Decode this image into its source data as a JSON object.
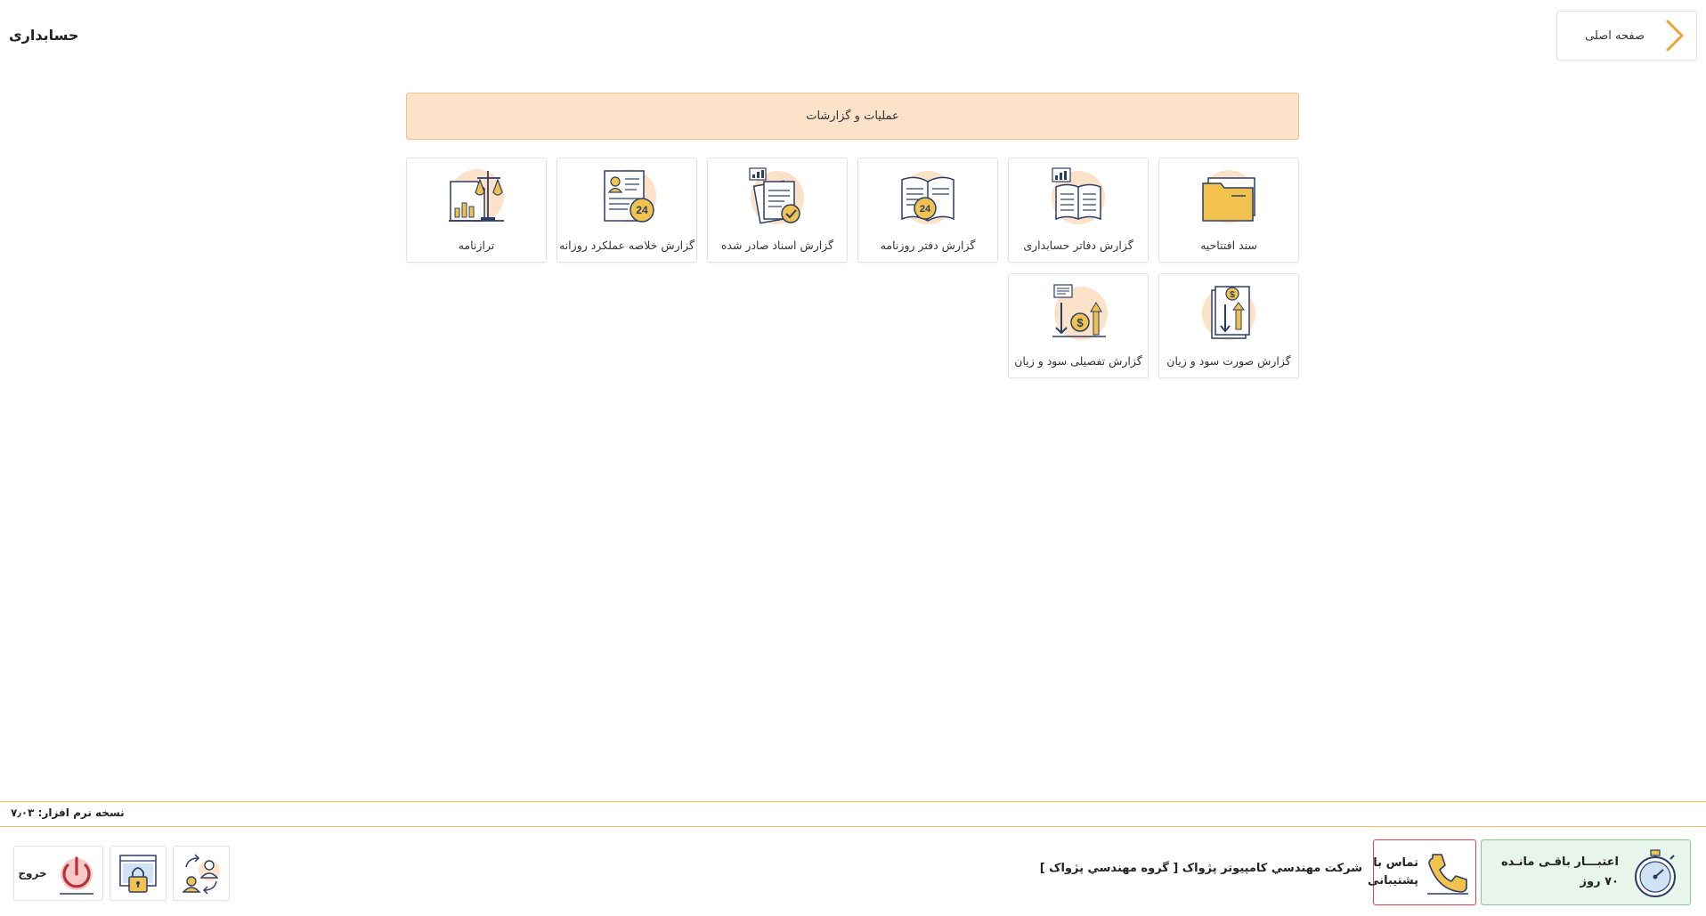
{
  "header": {
    "home_label": "صفحه اصلی",
    "home_icon": "chevron-right-icon",
    "title": "حسابداری"
  },
  "section": {
    "title": "عملیات و گزارشات"
  },
  "tiles": [
    {
      "label": "سند افتتاحیه",
      "icon": "folder-icon"
    },
    {
      "label": "گزارش دفاتر حسابداری",
      "icon": "ledger-book-chart-icon"
    },
    {
      "label": "گزارش دفتر روزنامه",
      "icon": "journal-book-24-icon",
      "badge": "24"
    },
    {
      "label": "گزارش اسناد صادر شده",
      "icon": "documents-check-icon"
    },
    {
      "label": "گزارش خلاصه عملکرد روزانه",
      "icon": "profile-sheet-24-icon",
      "badge": "24"
    },
    {
      "label": "ترازنامه",
      "icon": "balance-sheet-icon"
    },
    {
      "label": "گزارش صورت سود و زیان",
      "icon": "profit-loss-statement-icon"
    },
    {
      "label": "گزارش تفصیلی سود و زیان",
      "icon": "profit-loss-detail-icon"
    }
  ],
  "footer": {
    "version_label": "نسخه نرم افزار: ۷٫۰۳",
    "credit_line1": "اعتبـــار باقـی مانـده",
    "credit_line2": "۷۰ روز",
    "support_line1": "تماس با",
    "support_line2": "پشتیبانی",
    "company": "شركت مهندسي كامپيوتر پژواک [ گروه مهندسي پژواک ]",
    "logout_label": "خروج"
  },
  "colors": {
    "accent": "#e8a93a",
    "navy": "#2c3e66",
    "peach": "#fbe2c8",
    "peach_border": "#eebf8f",
    "credit_bg": "#e8f5ea",
    "support_border": "#d0464e"
  }
}
